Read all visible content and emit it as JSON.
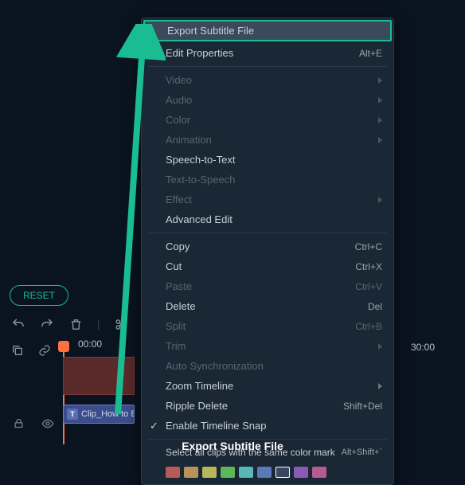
{
  "reset_label": "RESET",
  "ruler": {
    "t0": "00:00",
    "t1": "30:00"
  },
  "clip": {
    "icon_letter": "T",
    "label": "Clip_How to B"
  },
  "menu": {
    "export_subtitle": "Export Subtitle File",
    "edit_properties": "Edit Properties",
    "edit_properties_sc": "Alt+E",
    "video": "Video",
    "audio": "Audio",
    "color": "Color",
    "animation": "Animation",
    "speech_to_text": "Speech-to-Text",
    "text_to_speech": "Text-to-Speech",
    "effect": "Effect",
    "advanced_edit": "Advanced Edit",
    "copy": "Copy",
    "copy_sc": "Ctrl+C",
    "cut": "Cut",
    "cut_sc": "Ctrl+X",
    "paste": "Paste",
    "paste_sc": "Ctrl+V",
    "delete": "Delete",
    "delete_sc": "Del",
    "split": "Split",
    "split_sc": "Ctrl+B",
    "trim": "Trim",
    "auto_sync": "Auto Synchronization",
    "zoom_timeline": "Zoom Timeline",
    "ripple_delete": "Ripple Delete",
    "ripple_delete_sc": "Shift+Del",
    "enable_snap": "Enable Timeline Snap",
    "select_all_color": "Select all clips with the same color mark",
    "select_all_color_sc": "Alt+Shift+`"
  },
  "color_swatches": [
    "#b75a5a",
    "#b7935a",
    "#b7b75a",
    "#5ab75a",
    "#5ab7b7",
    "#5a7ab7",
    "#3a4560",
    "#8a5ab7",
    "#b75a93"
  ],
  "selected_swatch_index": 6,
  "caption": "Export Subtitle File"
}
